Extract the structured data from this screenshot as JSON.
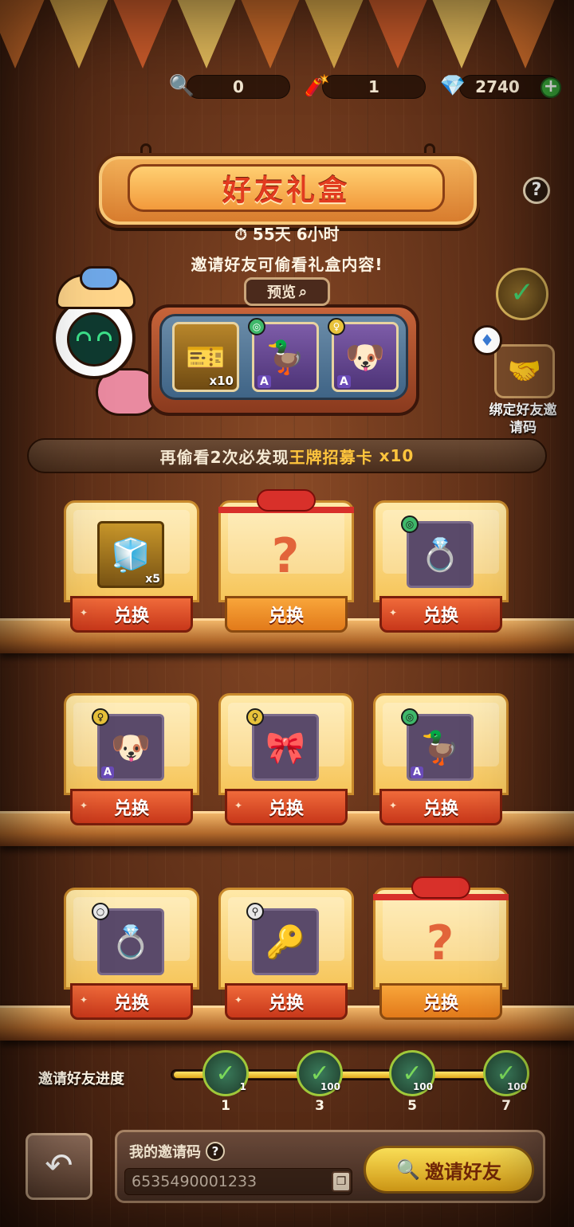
{
  "resources": [
    {
      "icon": "magnifier-icon",
      "glyph": "🔍",
      "value": "0"
    },
    {
      "icon": "firecracker-icon",
      "glyph": "🧨",
      "value": "1"
    },
    {
      "icon": "diamond-icon",
      "glyph": "💎",
      "value": "2740"
    }
  ],
  "plus_glyph": "+",
  "title": "好友礼盒",
  "help_glyph": "?",
  "timer": "⏱ 55天  6小时",
  "subtitle": "邀请好友可偷看礼盒内容!",
  "preview": {
    "label": "预览",
    "slots": [
      {
        "glyph": "🎫",
        "quantity": "x10",
        "style": "gold"
      },
      {
        "glyph": "🦆",
        "rank": "A",
        "badge": "◎",
        "badge_color": "#3fb86a",
        "style": "purple"
      },
      {
        "glyph": "🐶",
        "rank": "A",
        "badge": "♀",
        "badge_color": "#e8c23a",
        "style": "purple"
      }
    ]
  },
  "bind": {
    "check_glyph": "✓",
    "gem_glyph": "♦",
    "handshake_glyph": "🤝",
    "label_line1": "绑定好友邀",
    "label_line2": "请码"
  },
  "banner": {
    "prefix": "再偷看2次必发现",
    "highlight": "王牌招募卡",
    "suffix": "x10"
  },
  "exchange_label": "兑换",
  "spark_glyph": "✦",
  "shelves": [
    [
      {
        "type": "item",
        "glyph": "🧊",
        "quantity": "x5",
        "style": "gold"
      },
      {
        "type": "mystery",
        "glyph": "?"
      },
      {
        "type": "item",
        "glyph": "💍",
        "badge": "◎",
        "badge_color": "#3fb86a"
      }
    ],
    [
      {
        "type": "item",
        "glyph": "🐶",
        "rank": "A",
        "badge": "♀",
        "badge_color": "#e8c23a"
      },
      {
        "type": "item",
        "glyph": "🎀",
        "badge": "♀",
        "badge_color": "#e8c23a"
      },
      {
        "type": "item",
        "glyph": "🦆",
        "rank": "A",
        "badge": "◎",
        "badge_color": "#3fb86a"
      }
    ],
    [
      {
        "type": "item",
        "glyph": "💍",
        "badge": "○",
        "badge_color": "#e8e8e8"
      },
      {
        "type": "item",
        "glyph": "🔑",
        "badge": "⚲",
        "badge_color": "#e8e8e8"
      },
      {
        "type": "mystery",
        "glyph": "?"
      }
    ]
  ],
  "progress": {
    "label": "邀请好友进度",
    "fill_fraction": 0.95,
    "nodes": [
      {
        "label": "1",
        "glyph": "✓",
        "count": "1"
      },
      {
        "label": "3",
        "glyph": "✓",
        "count": "100"
      },
      {
        "label": "5",
        "glyph": "✓",
        "count": "100"
      },
      {
        "label": "7",
        "glyph": "✓",
        "count": "100"
      }
    ]
  },
  "bottom": {
    "back_glyph": "↶",
    "code_label": "我的邀请码",
    "code_help": "?",
    "code_value": "6535490001233",
    "copy_glyph": "❐",
    "invite_icon": "🔍",
    "invite_label": "邀请好友"
  }
}
